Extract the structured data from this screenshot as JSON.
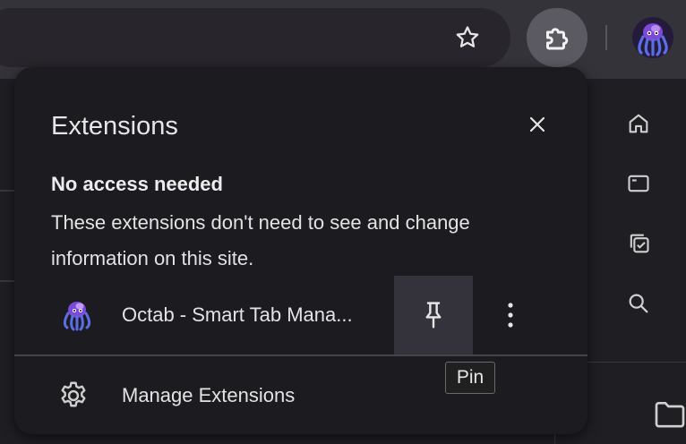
{
  "toolbar": {
    "bookmark_icon": "star-outline-icon",
    "extensions_icon": "puzzle-piece-icon",
    "profile_icon": "octopus-avatar"
  },
  "sidebar": {
    "icons": [
      "home-icon",
      "tab-window-icon",
      "copy-check-icon",
      "search-icon",
      "folder-icon"
    ]
  },
  "popup": {
    "title": "Extensions",
    "close_icon": "close-icon",
    "section_heading": "No access needed",
    "section_description": "These extensions don't need to see and change information on this site.",
    "extensions": [
      {
        "name": "Octab - Smart Tab Mana...",
        "icon": "octopus-logo",
        "pin_icon": "pin-icon",
        "more_icon": "more-vertical-icon"
      }
    ],
    "manage_label": "Manage Extensions",
    "manage_icon": "gear-icon"
  },
  "tooltip": {
    "text": "Pin"
  },
  "colors": {
    "toolbar_bg": "#35333a",
    "popup_bg": "#1c1b20",
    "text": "#e3e3e3",
    "accent_purple": "#7b4ad8"
  }
}
